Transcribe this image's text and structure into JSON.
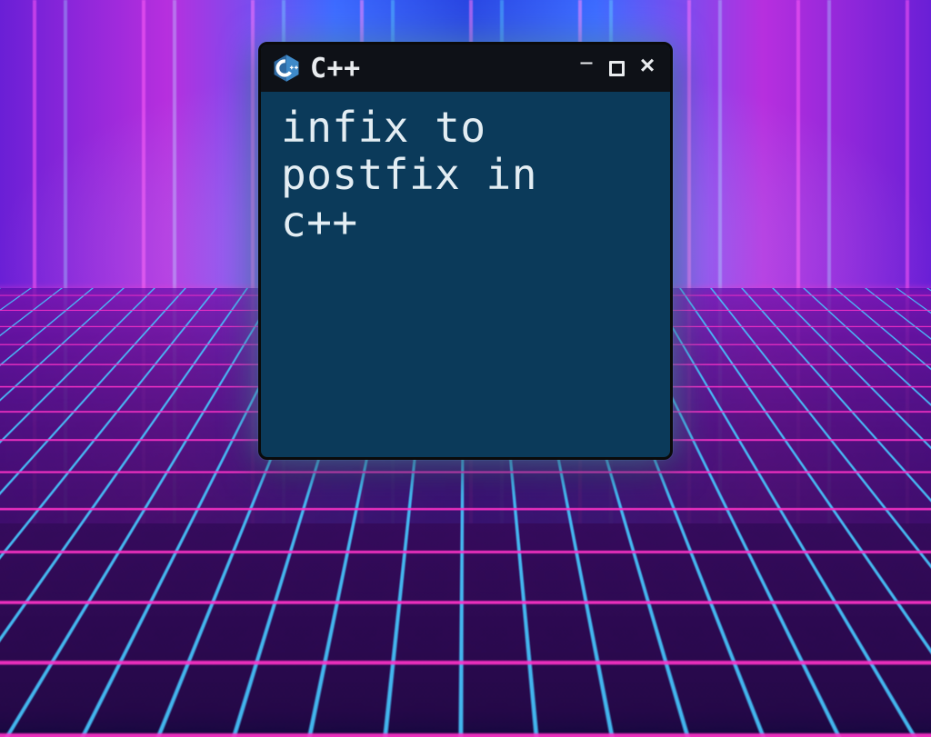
{
  "titlebar": {
    "title": "C++",
    "logo_label": "C++"
  },
  "controls": {
    "minimize_glyph": "–",
    "close_glyph": "×"
  },
  "content": {
    "text": "infix to\npostfix in\nc++"
  },
  "colors": {
    "window_bg": "#0b3a5a",
    "titlebar_bg": "#0e1117",
    "glow": "#9fe7ff"
  }
}
